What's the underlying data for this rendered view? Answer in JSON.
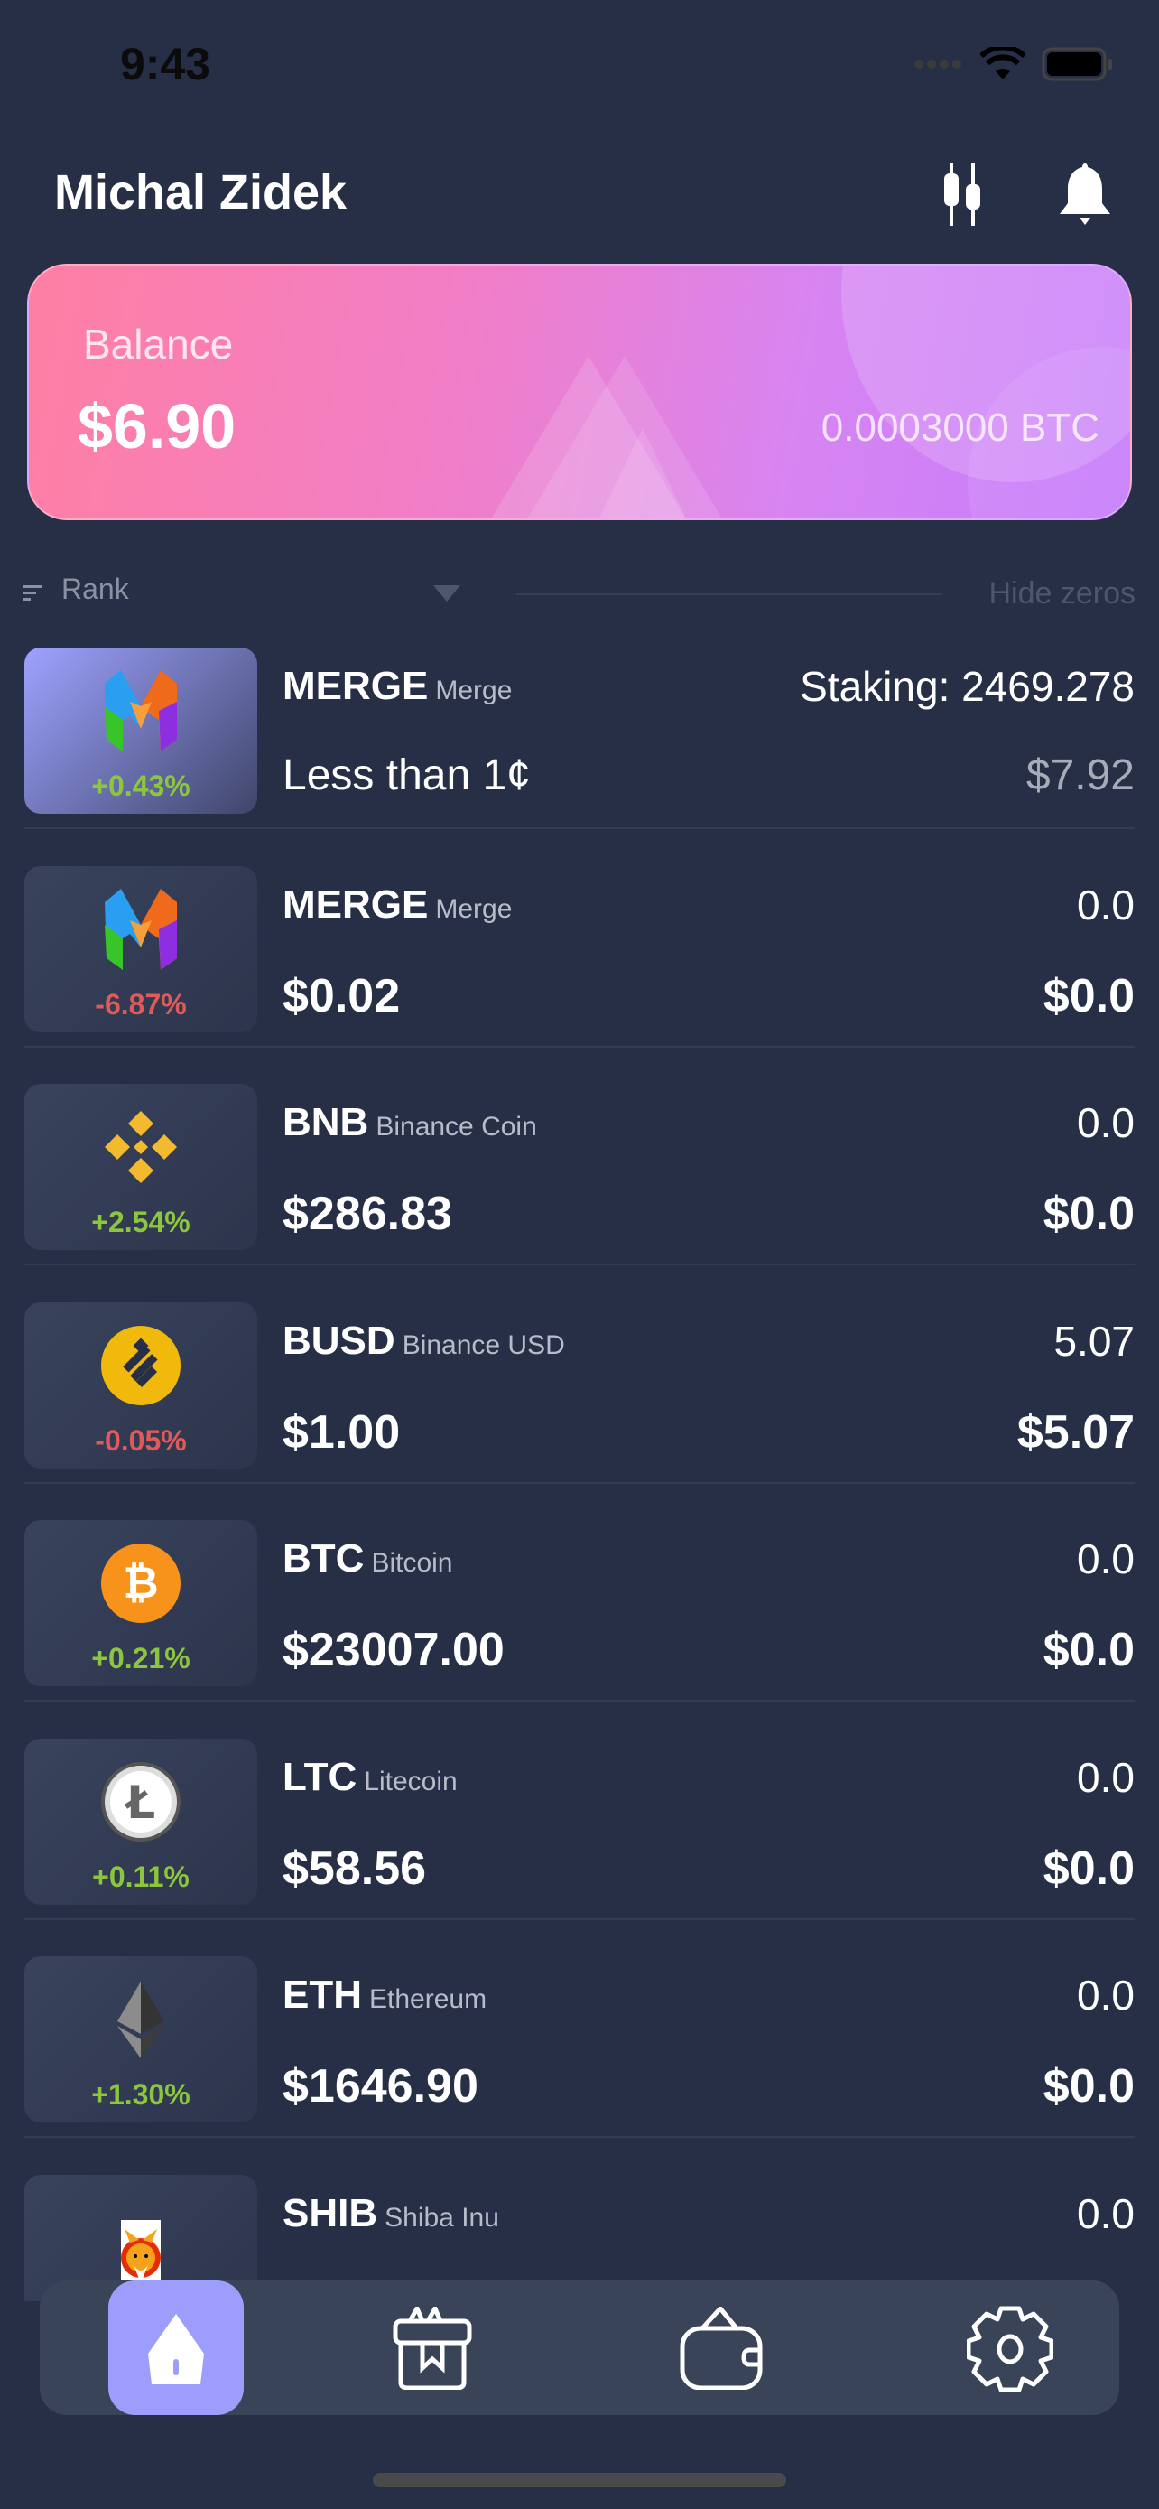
{
  "status_bar": {
    "time": "9:43"
  },
  "header": {
    "username": "Michal Zidek",
    "icons": [
      "candlestick-chart-icon",
      "bell-icon"
    ]
  },
  "balance_card": {
    "label": "Balance",
    "value": "$6.90",
    "btc": "0.0003000 BTC"
  },
  "sort_bar": {
    "sort_label": "Rank",
    "hide_zeros": "Hide zeros"
  },
  "colors": {
    "positive": "#8cc63f",
    "negative": "#e05a5a",
    "active_nav": "#9d9dfb",
    "background": "#262f46"
  },
  "coins": [
    {
      "symbol": "MERGE",
      "name": "Merge",
      "change": "+0.43%",
      "top_right": "Staking: 2469.278",
      "price": "Less than 1¢",
      "value": "$7.92",
      "icon": "merge-icon"
    },
    {
      "symbol": "MERGE",
      "name": "Merge",
      "change": "-6.87%",
      "top_right": "0.0",
      "price": "$0.02",
      "value": "$0.0",
      "icon": "merge-icon"
    },
    {
      "symbol": "BNB",
      "name": "Binance Coin",
      "change": "+2.54%",
      "top_right": "0.0",
      "price": "$286.83",
      "value": "$0.0",
      "icon": "bnb-icon"
    },
    {
      "symbol": "BUSD",
      "name": "Binance USD",
      "change": "-0.05%",
      "top_right": "5.07",
      "price": "$1.00",
      "value": "$5.07",
      "icon": "busd-icon"
    },
    {
      "symbol": "BTC",
      "name": "Bitcoin",
      "change": "+0.21%",
      "top_right": "0.0",
      "price": "$23007.00",
      "value": "$0.0",
      "icon": "bitcoin-icon"
    },
    {
      "symbol": "LTC",
      "name": "Litecoin",
      "change": "+0.11%",
      "top_right": "0.0",
      "price": "$58.56",
      "value": "$0.0",
      "icon": "litecoin-icon"
    },
    {
      "symbol": "ETH",
      "name": "Ethereum",
      "change": "+1.30%",
      "top_right": "0.0",
      "price": "$1646.90",
      "value": "$0.0",
      "icon": "ethereum-icon"
    },
    {
      "symbol": "SHIB",
      "name": "Shiba Inu",
      "change": "",
      "top_right": "0.0",
      "price": "",
      "value": "",
      "icon": "shiba-inu-icon"
    }
  ],
  "nav": {
    "items": [
      {
        "icon": "home-icon",
        "active": true
      },
      {
        "icon": "gift-icon",
        "active": false
      },
      {
        "icon": "wallet-icon",
        "active": false
      },
      {
        "icon": "settings-gear-icon",
        "active": false
      }
    ]
  }
}
